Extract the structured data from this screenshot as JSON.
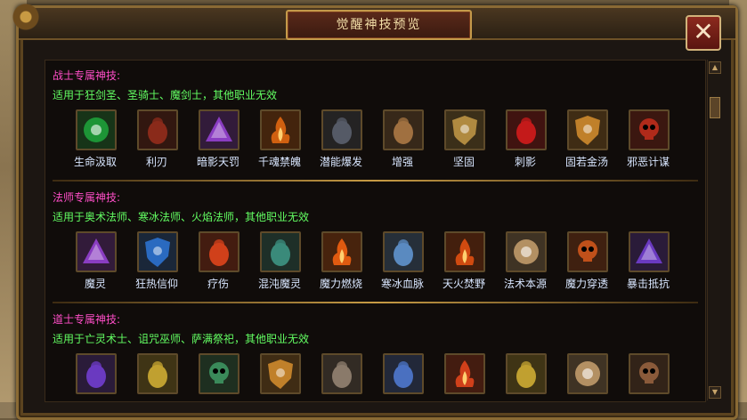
{
  "window": {
    "title": "觉醒神技预览",
    "close_label": "✕"
  },
  "sections": [
    {
      "title": "战士专属神技:",
      "desc": "适用于狂剑圣、圣骑士、魔剑士，其他职业无效",
      "skills": [
        {
          "name": "生命汲取",
          "icon": "green-orb-icon",
          "color": "#1ea03a"
        },
        {
          "name": "利刃",
          "icon": "blade-icon",
          "color": "#8a2a1a"
        },
        {
          "name": "暗影天罚",
          "icon": "rainbow-prism-icon",
          "color": "#8a3dc2"
        },
        {
          "name": "千魂禁魄",
          "icon": "fire-blade-icon",
          "color": "#d06010"
        },
        {
          "name": "潜能爆发",
          "icon": "hooded-figure-icon",
          "color": "#555a66"
        },
        {
          "name": "增强",
          "icon": "warrior-icon",
          "color": "#a07040"
        },
        {
          "name": "坚固",
          "icon": "shield-icon",
          "color": "#b08a40"
        },
        {
          "name": "刺影",
          "icon": "assassin-icon",
          "color": "#c41a1a"
        },
        {
          "name": "固若金汤",
          "icon": "skull-shield-icon",
          "color": "#c0802a"
        },
        {
          "name": "邪恶计谋",
          "icon": "demon-icon",
          "color": "#b02a1a"
        }
      ]
    },
    {
      "title": "法师专属神技:",
      "desc": "适用于奥术法师、寒冰法师、火焰法师，其他职业无效",
      "skills": [
        {
          "name": "魔灵",
          "icon": "rainbow-prism-icon",
          "color": "#8a3dc2"
        },
        {
          "name": "狂热信仰",
          "icon": "shield-icon",
          "color": "#2a6ac0"
        },
        {
          "name": "疗伤",
          "icon": "potion-icon",
          "color": "#d0401a"
        },
        {
          "name": "混沌魔灵",
          "icon": "chaos-icon",
          "color": "#3a8a7a"
        },
        {
          "name": "魔力燃烧",
          "icon": "flame-icon",
          "color": "#e05a10"
        },
        {
          "name": "寒冰血脉",
          "icon": "ice-figure-icon",
          "color": "#5a8ac0"
        },
        {
          "name": "天火焚野",
          "icon": "heart-fire-icon",
          "color": "#d04a10"
        },
        {
          "name": "法术本源",
          "icon": "eye-icon",
          "color": "#c09a6a"
        },
        {
          "name": "魔力穿透",
          "icon": "demon-face-icon",
          "color": "#c0501a"
        },
        {
          "name": "暴击抵抗",
          "icon": "lightning-icon",
          "color": "#6a3ac0"
        }
      ]
    },
    {
      "title": "道士专属神技:",
      "desc": "适用于亡灵术士、诅咒巫师、萨满祭祀，其他职业无效",
      "skills": [
        {
          "name": "",
          "icon": "spirit-icon",
          "color": "#6a3ac0"
        },
        {
          "name": "",
          "icon": "runner-icon",
          "color": "#c0a030"
        },
        {
          "name": "",
          "icon": "skull-icon",
          "color": "#3a8a5a"
        },
        {
          "name": "",
          "icon": "skull-shield-icon",
          "color": "#c0802a"
        },
        {
          "name": "",
          "icon": "hands-icon",
          "color": "#8a7a6a"
        },
        {
          "name": "",
          "icon": "ice-figure-icon",
          "color": "#4a70c0"
        },
        {
          "name": "",
          "icon": "fire-figure-icon",
          "color": "#d0401a"
        },
        {
          "name": "",
          "icon": "runner-icon",
          "color": "#c0a030"
        },
        {
          "name": "",
          "icon": "eye-icon",
          "color": "#c09a6a"
        },
        {
          "name": "",
          "icon": "scream-icon",
          "color": "#8a5a3a"
        }
      ]
    }
  ]
}
